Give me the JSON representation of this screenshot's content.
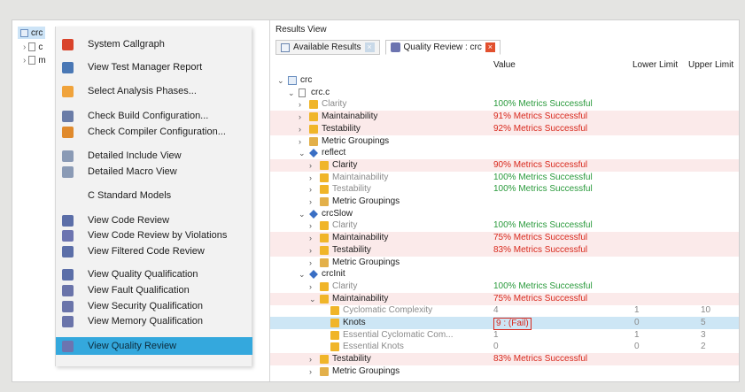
{
  "tree": {
    "root_label": "crc",
    "children": [
      "c",
      "m"
    ]
  },
  "menu": {
    "items": [
      {
        "label": "System Callgraph",
        "icon": "callgraph-icon",
        "color": "#d9432b",
        "selected": false
      },
      {
        "label": "View Test Manager Report",
        "icon": "report-icon",
        "color": "#4a78b5",
        "selected": false
      },
      {
        "label": "Select Analysis Phases...",
        "icon": "phases-icon",
        "color": "#f0a33b",
        "selected": false
      },
      {
        "label": "Check Build Configuration...",
        "icon": "build-config-icon",
        "color": "#6a7ca7",
        "selected": false
      },
      {
        "label": "Check Compiler Configuration...",
        "icon": "compiler-config-icon",
        "color": "#e08a2c",
        "selected": false
      },
      {
        "label": "Detailed Include View",
        "icon": "include-view-icon",
        "color": "#8a9ab5",
        "selected": false
      },
      {
        "label": "Detailed Macro View",
        "icon": "macro-view-icon",
        "color": "#8a9ab5",
        "selected": false
      },
      {
        "label": "C Standard Models",
        "icon": "",
        "color": "",
        "selected": false
      },
      {
        "label": "View Code Review",
        "icon": "code-review-icon",
        "color": "#5b6ea8",
        "selected": false
      },
      {
        "label": "View Code Review by Violations",
        "icon": "code-review-violations-icon",
        "color": "#6c74b0",
        "selected": false
      },
      {
        "label": "View Filtered Code Review",
        "icon": "filtered-review-icon",
        "color": "#5b6ea8",
        "selected": false
      },
      {
        "label": "View Quality Qualification",
        "icon": "quality-qualification-icon",
        "color": "#5b6ea8",
        "selected": false
      },
      {
        "label": "View Fault Qualification",
        "icon": "fault-qualification-icon",
        "color": "#6a74aa",
        "selected": false
      },
      {
        "label": "View Security Qualification",
        "icon": "security-qualification-icon",
        "color": "#6a74aa",
        "selected": false
      },
      {
        "label": "View Memory Qualification",
        "icon": "memory-qualification-icon",
        "color": "#6a74aa",
        "selected": false
      },
      {
        "label": "View Quality Review",
        "icon": "quality-review-icon",
        "color": "#6c74b0",
        "selected": true
      }
    ]
  },
  "results": {
    "title": "Results View",
    "tabs": [
      {
        "label": "Available Results",
        "icon": "results-icon"
      },
      {
        "label": "Quality Review : crc",
        "icon": "quality-review-icon"
      }
    ],
    "columns": {
      "value": "Value",
      "lower": "Lower Limit",
      "upper": "Upper Limit"
    },
    "rows": [
      {
        "indent": 0,
        "twisty": "v",
        "icon": "project",
        "name": "crc",
        "value": "",
        "vcolor": "",
        "lower": "",
        "upper": "",
        "bg": "",
        "namegrey": false
      },
      {
        "indent": 1,
        "twisty": "v",
        "icon": "file",
        "name": "crc.c",
        "value": "",
        "vcolor": "",
        "lower": "",
        "upper": "",
        "bg": "",
        "namegrey": false
      },
      {
        "indent": 2,
        "twisty": ">",
        "icon": "metric",
        "name": "Clarity",
        "value": "100% Metrics Successful",
        "vcolor": "green",
        "lower": "",
        "upper": "",
        "bg": "",
        "namegrey": true
      },
      {
        "indent": 2,
        "twisty": ">",
        "icon": "metric",
        "name": "Maintainability",
        "value": "91% Metrics Successful",
        "vcolor": "red",
        "lower": "",
        "upper": "",
        "bg": "red",
        "namegrey": false
      },
      {
        "indent": 2,
        "twisty": ">",
        "icon": "metric",
        "name": "Testability",
        "value": "92% Metrics Successful",
        "vcolor": "red",
        "lower": "",
        "upper": "",
        "bg": "red",
        "namegrey": false
      },
      {
        "indent": 2,
        "twisty": ">",
        "icon": "folder",
        "name": "Metric Groupings",
        "value": "",
        "vcolor": "",
        "lower": "",
        "upper": "",
        "bg": "",
        "namegrey": false
      },
      {
        "indent": 2,
        "twisty": "v",
        "icon": "function",
        "name": "reflect",
        "value": "",
        "vcolor": "",
        "lower": "",
        "upper": "",
        "bg": "",
        "namegrey": false
      },
      {
        "indent": 3,
        "twisty": ">",
        "icon": "metric",
        "name": "Clarity",
        "value": "90% Metrics Successful",
        "vcolor": "red",
        "lower": "",
        "upper": "",
        "bg": "red",
        "namegrey": false
      },
      {
        "indent": 3,
        "twisty": ">",
        "icon": "metric",
        "name": "Maintainability",
        "value": "100% Metrics Successful",
        "vcolor": "green",
        "lower": "",
        "upper": "",
        "bg": "",
        "namegrey": true
      },
      {
        "indent": 3,
        "twisty": ">",
        "icon": "metric",
        "name": "Testability",
        "value": "100% Metrics Successful",
        "vcolor": "green",
        "lower": "",
        "upper": "",
        "bg": "",
        "namegrey": true
      },
      {
        "indent": 3,
        "twisty": ">",
        "icon": "folder",
        "name": "Metric Groupings",
        "value": "",
        "vcolor": "",
        "lower": "",
        "upper": "",
        "bg": "",
        "namegrey": false
      },
      {
        "indent": 2,
        "twisty": "v",
        "icon": "function",
        "name": "crcSlow",
        "value": "",
        "vcolor": "",
        "lower": "",
        "upper": "",
        "bg": "",
        "namegrey": false
      },
      {
        "indent": 3,
        "twisty": ">",
        "icon": "metric",
        "name": "Clarity",
        "value": "100% Metrics Successful",
        "vcolor": "green",
        "lower": "",
        "upper": "",
        "bg": "",
        "namegrey": true
      },
      {
        "indent": 3,
        "twisty": ">",
        "icon": "metric",
        "name": "Maintainability",
        "value": "75% Metrics Successful",
        "vcolor": "red",
        "lower": "",
        "upper": "",
        "bg": "red",
        "namegrey": false
      },
      {
        "indent": 3,
        "twisty": ">",
        "icon": "metric",
        "name": "Testability",
        "value": "83% Metrics Successful",
        "vcolor": "red",
        "lower": "",
        "upper": "",
        "bg": "red",
        "namegrey": false
      },
      {
        "indent": 3,
        "twisty": ">",
        "icon": "folder",
        "name": "Metric Groupings",
        "value": "",
        "vcolor": "",
        "lower": "",
        "upper": "",
        "bg": "",
        "namegrey": false
      },
      {
        "indent": 2,
        "twisty": "v",
        "icon": "function",
        "name": "crcInit",
        "value": "",
        "vcolor": "",
        "lower": "",
        "upper": "",
        "bg": "",
        "namegrey": false
      },
      {
        "indent": 3,
        "twisty": ">",
        "icon": "metric",
        "name": "Clarity",
        "value": "100% Metrics Successful",
        "vcolor": "green",
        "lower": "",
        "upper": "",
        "bg": "",
        "namegrey": true
      },
      {
        "indent": 3,
        "twisty": "v",
        "icon": "metric",
        "name": "Maintainability",
        "value": "75% Metrics Successful",
        "vcolor": "red",
        "lower": "",
        "upper": "",
        "bg": "red",
        "namegrey": false
      },
      {
        "indent": 4,
        "twisty": "",
        "icon": "leaf",
        "name": "Cyclomatic Complexity",
        "value": "4",
        "vcolor": "grey",
        "lower": "1",
        "upper": "10",
        "bg": "",
        "namegrey": true
      },
      {
        "indent": 4,
        "twisty": "",
        "icon": "leaf",
        "name": "Knots",
        "value": "9 : (Fail)",
        "vcolor": "red",
        "lower": "0",
        "upper": "5",
        "bg": "hl",
        "namegrey": false
      },
      {
        "indent": 4,
        "twisty": "",
        "icon": "leaf",
        "name": "Essential Cyclomatic Com...",
        "value": "1",
        "vcolor": "grey",
        "lower": "1",
        "upper": "3",
        "bg": "",
        "namegrey": true
      },
      {
        "indent": 4,
        "twisty": "",
        "icon": "leaf",
        "name": "Essential Knots",
        "value": "0",
        "vcolor": "grey",
        "lower": "0",
        "upper": "2",
        "bg": "",
        "namegrey": true
      },
      {
        "indent": 3,
        "twisty": ">",
        "icon": "metric",
        "name": "Testability",
        "value": "83% Metrics Successful",
        "vcolor": "red",
        "lower": "",
        "upper": "",
        "bg": "red",
        "namegrey": false
      },
      {
        "indent": 3,
        "twisty": ">",
        "icon": "folder",
        "name": "Metric Groupings",
        "value": "",
        "vcolor": "",
        "lower": "",
        "upper": "",
        "bg": "",
        "namegrey": false
      }
    ]
  }
}
